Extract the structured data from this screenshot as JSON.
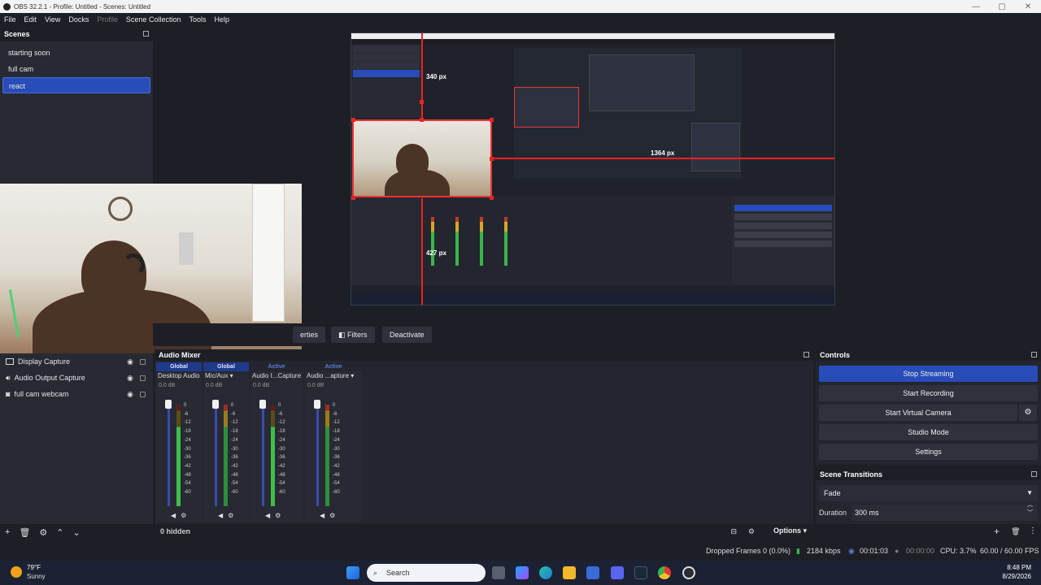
{
  "window": {
    "title": "OBS 32.2.1 - Profile: Untitled - Scenes: Untitled",
    "minimize": "—",
    "maximize": "▢",
    "close": "✕"
  },
  "menu": [
    "File",
    "Edit",
    "View",
    "Docks",
    "Profile",
    "Scene Collection",
    "Tools",
    "Help"
  ],
  "scenes": {
    "title": "Scenes",
    "items": [
      "starting soon",
      "full cam",
      "react"
    ],
    "active": "react"
  },
  "preview": {
    "top_distance": "340 px",
    "right_distance": "1364 px",
    "bottom_distance": "427 px"
  },
  "source_toolbar": {
    "properties": "erties",
    "filters": "Filters",
    "deactivate": "Deactivate"
  },
  "sources": {
    "items": [
      {
        "name": "Display Capture",
        "icon": "monitor-icon"
      },
      {
        "name": "Audio Output Capture",
        "icon": "speaker-icon"
      },
      {
        "name": "full cam webcam",
        "icon": "camera-icon"
      }
    ]
  },
  "mixer": {
    "title": "Audio Mixer",
    "channels": [
      {
        "status": "Global",
        "name": "Desktop Audio",
        "db": "0.0 dB"
      },
      {
        "status": "Global",
        "name": "Mic/Aux",
        "db": "0.0 dB"
      },
      {
        "status": "Active",
        "name": "Audio I...Capture",
        "db": "0.0 dB"
      },
      {
        "status": "Active",
        "name": "Audio ...apture",
        "db": "0.0 dB"
      }
    ],
    "scale": [
      "0",
      "-6",
      "-12",
      "-18",
      "-24",
      "-30",
      "-36",
      "-42",
      "-48",
      "-54",
      "-60"
    ],
    "hidden": "0 hidden",
    "options": "Options"
  },
  "controls": {
    "title": "Controls",
    "stop_streaming": "Stop Streaming",
    "start_recording": "Start Recording",
    "start_virtual_camera": "Start Virtual Camera",
    "studio_mode": "Studio Mode",
    "settings": "Settings"
  },
  "transitions": {
    "title": "Scene Transitions",
    "selected": "Fade",
    "duration_label": "Duration",
    "duration_value": "300 ms"
  },
  "status": {
    "dropped_frames": "Dropped Frames 0 (0.0%)",
    "bitrate": "2184 kbps",
    "stream_time": "00:01:03",
    "record_time": "00:00:00",
    "cpu": "CPU: 3.7%",
    "fps": "60.00 / 60.00 FPS"
  },
  "taskbar": {
    "temperature": "79°F",
    "condition": "Sunny",
    "search_placeholder": "Search",
    "time": "8:48 PM",
    "date": "8/29/2026"
  },
  "colors": {
    "accent": "#284cb8",
    "background": "#1d1f26",
    "panel": "#272a33",
    "selection_red": "#e22222"
  }
}
